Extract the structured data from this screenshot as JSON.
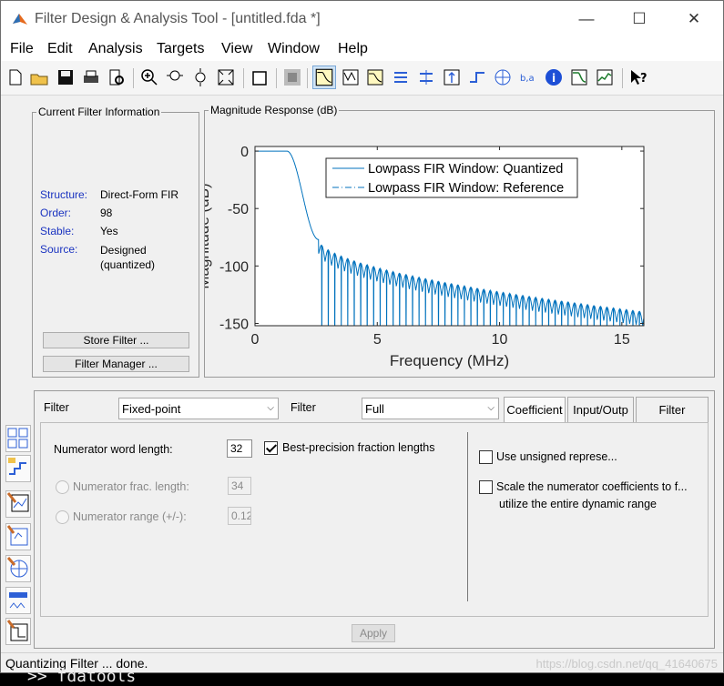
{
  "window": {
    "title": "Filter Design & Analysis Tool -  [untitled.fda *]",
    "minimize": "—",
    "maximize": "☐",
    "close": "✕"
  },
  "menu": [
    "File",
    "Edit",
    "Analysis",
    "Targets",
    "View",
    "Window",
    "Help"
  ],
  "filter_info": {
    "group_title": "Current Filter Information",
    "rows": [
      {
        "label": "Structure:",
        "value": "Direct-Form FIR"
      },
      {
        "label": "Order:",
        "value": "98"
      },
      {
        "label": "Stable:",
        "value": "Yes"
      },
      {
        "label": "Source:",
        "value": "Designed\n(quantized)"
      }
    ],
    "store_button": "Store Filter ...",
    "manager_button": "Filter Manager ..."
  },
  "plot": {
    "group_title": "Magnitude Response (dB)"
  },
  "chart_data": {
    "type": "line",
    "title": "",
    "xlabel": "Frequency (MHz)",
    "ylabel": "Magnitude (dB)",
    "xlim": [
      0,
      15.9
    ],
    "ylim": [
      -152,
      4
    ],
    "xticks": [
      0,
      5,
      10,
      15
    ],
    "yticks": [
      0,
      -50,
      -100,
      -150
    ],
    "grid": false,
    "legend": "top-right",
    "series": [
      {
        "name": "Lowpass FIR Window: Quantized",
        "style": "solid",
        "color": "#0072bd",
        "passband_edge_mhz": 1.3,
        "stopband_start_mhz": 2.6,
        "stopband_level_db": [
          -77,
          -140
        ]
      },
      {
        "name": "Lowpass FIR Window: Reference",
        "style": "dashdot",
        "color": "#0072bd"
      }
    ]
  },
  "quant": {
    "filter_label_1": "Filter",
    "arithmetic": "Fixed-point",
    "filter_label_2": "Filter",
    "precision": "Full",
    "tabs": [
      "Coefficient",
      "Input/Outp",
      "Filter"
    ],
    "num_word_length_label": "Numerator word length:",
    "num_word_length": "32",
    "best_precision_label": "Best-precision fraction lengths",
    "num_frac_label": "Numerator frac. length:",
    "num_frac": "34",
    "num_range_label": "Numerator range (+/-):",
    "num_range": "0.12",
    "unsigned_label": "Use unsigned represe...",
    "scale_label": "Scale the numerator coefficients to f...",
    "scale_label_2": "utilize the entire dynamic range",
    "apply": "Apply"
  },
  "status": {
    "text": "Quantizing Filter ... done.",
    "watermark": "https://blog.csdn.net/qq_41640675"
  },
  "behind_text": ">> fdatools"
}
